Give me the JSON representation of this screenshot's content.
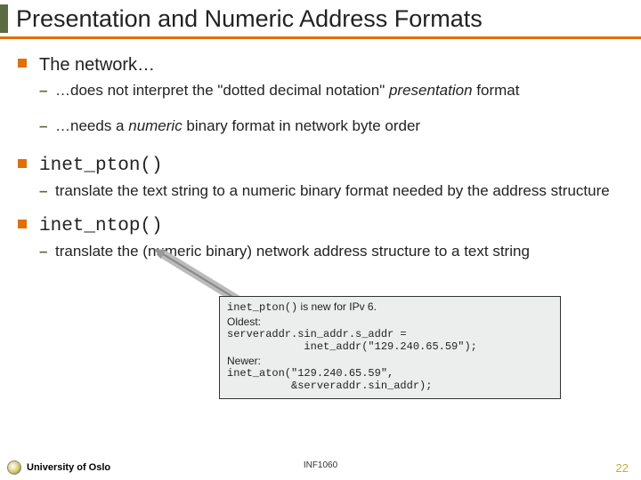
{
  "title": "Presentation and Numeric Address Formats",
  "items": [
    {
      "head": "The network…",
      "mono": false,
      "subs": [
        {
          "prefix": "…does not interpret the \"dotted decimal notation\" ",
          "ital": "presentation",
          "suffix": " format"
        },
        {
          "prefix": "…needs a ",
          "ital": "numeric",
          "suffix": " binary format in network byte order"
        }
      ]
    },
    {
      "head": "inet_pton()",
      "mono": true,
      "subs": [
        {
          "prefix": "translate the text string to a numeric binary format needed by the address structure",
          "ital": "",
          "suffix": ""
        }
      ]
    },
    {
      "head": "inet_ntop()",
      "mono": true,
      "subs": [
        {
          "prefix": "translate the (numeric binary) network address structure to a text string",
          "ital": "",
          "suffix": ""
        }
      ]
    }
  ],
  "callout": {
    "line1_code": "inet_pton()",
    "line1_rest": " is new for IPv 6.",
    "oldest_label": "Oldest:",
    "oldest_code": "serveraddr.sin_addr.s_addr =\n            inet_addr(\"129.240.65.59\");",
    "newer_label": "Newer:",
    "newer_code": "inet_aton(\"129.240.65.59\",\n          &serveraddr.sin_addr);"
  },
  "footer": {
    "org": "University of Oslo",
    "course": "INF1060",
    "page": "22"
  }
}
